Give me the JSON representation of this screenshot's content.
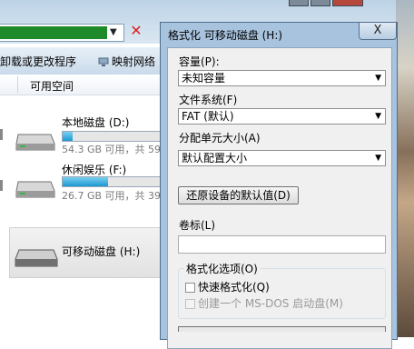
{
  "explorer": {
    "toolbar": {
      "uninstall_label": "卸载或更改程序",
      "map_network_label": "映射网络"
    },
    "column_header": {
      "free_space_label": "可用空间"
    },
    "drives": [
      {
        "name": "本地磁盘 (D:)",
        "info": "54.3 GB 可用，共 59.",
        "used_fraction": 0.1
      },
      {
        "name": "休闲娱乐 (F:)",
        "info": "26.7 GB 可用，共 39.",
        "used_fraction": 0.45
      },
      {
        "name": "可移动磁盘 (H:)"
      }
    ]
  },
  "dialog": {
    "title": "格式化 可移动磁盘 (H:)",
    "close_symbol": "X",
    "capacity_label": "容量(P):",
    "capacity_value": "未知容量",
    "filesystem_label": "文件系统(F)",
    "filesystem_value": "FAT (默认)",
    "allocation_label": "分配单元大小(A)",
    "allocation_value": "默认配置大小",
    "restore_defaults_label": "还原设备的默认值(D)",
    "volume_label_label": "卷标(L)",
    "volume_label_value": "",
    "format_options_label": "格式化选项(O)",
    "quick_format_label": "快速格式化(Q)",
    "msdos_label": "创建一个 MS-DOS 启动盘(M)"
  },
  "colors": {
    "dialog_frame": "#a8c3de",
    "progress_fill": "#1c97d2",
    "close_red": "#d22222"
  }
}
